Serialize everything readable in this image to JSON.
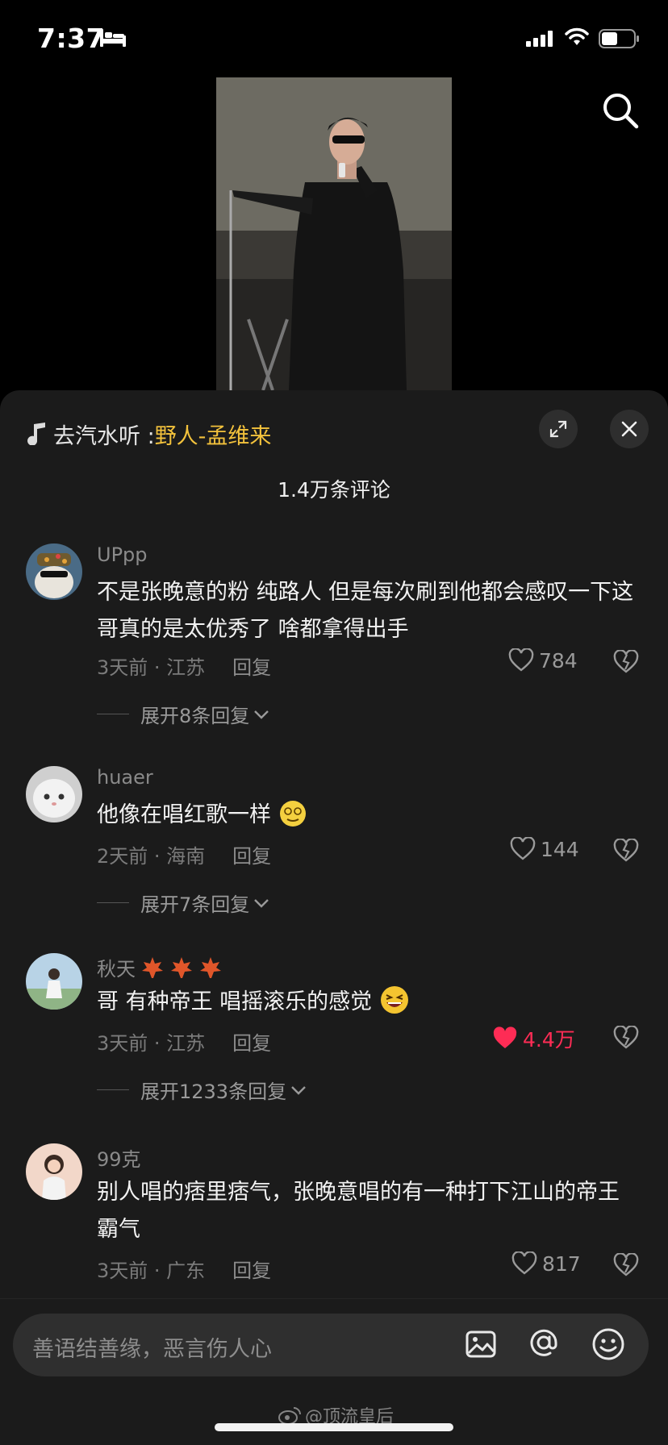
{
  "status": {
    "time": "7:37",
    "battery_level": 0.5
  },
  "music": {
    "prefix": "去汽水听 : ",
    "song": "野人-孟维来"
  },
  "comments_header": "1.4万条评论",
  "comments": [
    {
      "user": "UPpp",
      "text": "不是张晚意的粉 纯路人 但是每次刷到他都会感叹一下这哥真的是太优秀了 啥都拿得出手",
      "meta": "3天前 · 江苏",
      "reply": "回复",
      "likes": "784",
      "liked": false,
      "expand": "展开8条回复"
    },
    {
      "user": "huaer",
      "text": "他像在唱红歌一样",
      "meta": "2天前 · 海南",
      "reply": "回复",
      "likes": "144",
      "liked": false,
      "expand": "展开7条回复"
    },
    {
      "user": "秋天",
      "text": "哥 有种帝王 唱摇滚乐的感觉",
      "meta": "3天前 · 江苏",
      "reply": "回复",
      "likes": "4.4万",
      "liked": true,
      "expand": "展开1233条回复"
    },
    {
      "user": "99克",
      "text": "别人唱的痞里痞气，张晚意唱的有一种打下江山的帝王霸气",
      "meta": "3天前 · 广东",
      "reply": "回复",
      "likes": "817",
      "liked": false
    }
  ],
  "input": {
    "placeholder": "善语结善缘，恶言伤人心"
  },
  "watermark": "@顶流皇后",
  "colors": {
    "accent_song": "#f3c23c",
    "liked_red": "#fe2c55",
    "sheet_bg": "#1b1b1b"
  }
}
